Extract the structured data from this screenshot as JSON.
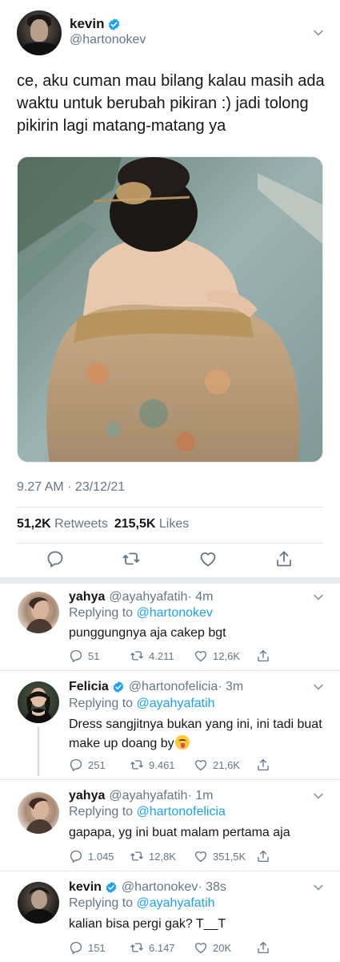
{
  "tweet": {
    "author_name": "kevin",
    "author_handle": "@hartonokev",
    "text": "ce, aku cuman mau bilang kalau masih ada waktu untuk berubah pikiran :) jadi tolong pikirin lagi matang-matang ya",
    "time": "9.27 AM · 23/12/21",
    "retweets_count": "51,2K",
    "retweets_label": "Retweets",
    "likes_count": "215,5K",
    "likes_label": "Likes"
  },
  "replies": [
    {
      "name": "yahya",
      "handle": "@ayahyafatih",
      "time": "· 4m",
      "replying_prefix": "Replying to",
      "replying_to": "@hartonokev",
      "text": "punggungnya aja cakep bgt",
      "replies": "51",
      "retweets": "4.211",
      "likes": "12,6K"
    },
    {
      "name": "Felicia",
      "handle": "@hartonofelicia",
      "time": "· 3m",
      "replying_prefix": "Replying to",
      "replying_to": "@ayahyafatih",
      "text": "Dress sangjitnya bukan yang ini, ini tadi buat make up doang by",
      "replies": "251",
      "retweets": "9.461",
      "likes": "21,6K"
    },
    {
      "name": "yahya",
      "handle": "@ayahyafatih",
      "time": "· 1m",
      "replying_prefix": "Replying to",
      "replying_to": "@hartonofelicia",
      "text": "gapapa, yg ini buat malam pertama aja",
      "replies": "1.045",
      "retweets": "12,8K",
      "likes": "351,5K"
    },
    {
      "name": "kevin",
      "handle": "@hartonokev",
      "time": "· 38s",
      "replying_prefix": "Replying to",
      "replying_to": "@ayahyafatih",
      "text": "kalian bisa pergi gak? T__T",
      "replies": "151",
      "retweets": "6.147",
      "likes": "20K"
    }
  ],
  "colors": {
    "accent": "#1da1f2",
    "text": "#14171a",
    "secondary": "#657786",
    "divider": "#e1e8ed"
  },
  "icons": [
    "verified-badge-icon",
    "chevron-down-icon",
    "reply-icon",
    "retweet-icon",
    "like-icon",
    "share-icon",
    "tongue-emoji-icon"
  ]
}
